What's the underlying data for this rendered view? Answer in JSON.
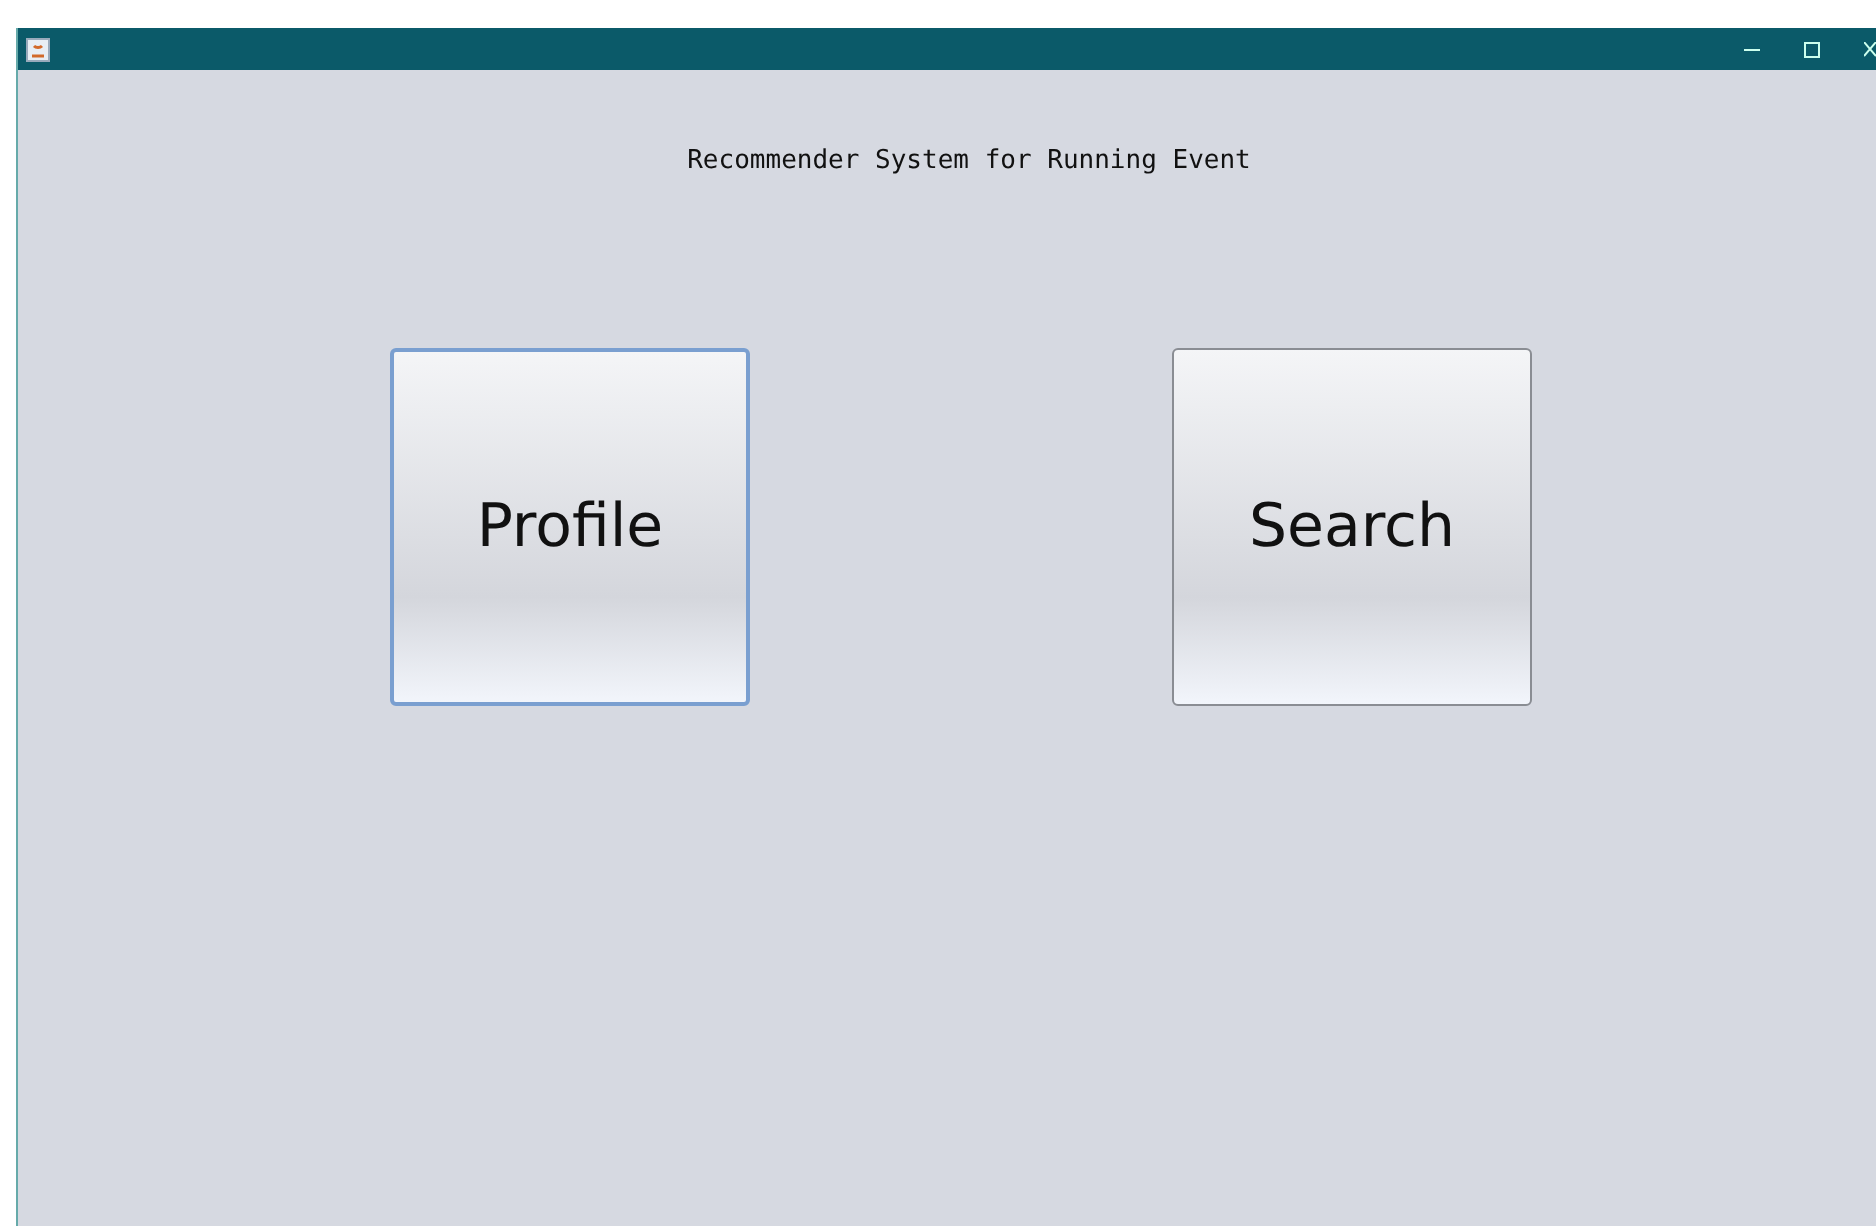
{
  "window": {
    "heading": "Recommender System for Running Event"
  },
  "buttons": [
    {
      "label": "Profile",
      "focused": true
    },
    {
      "label": "Search",
      "focused": false
    }
  ]
}
